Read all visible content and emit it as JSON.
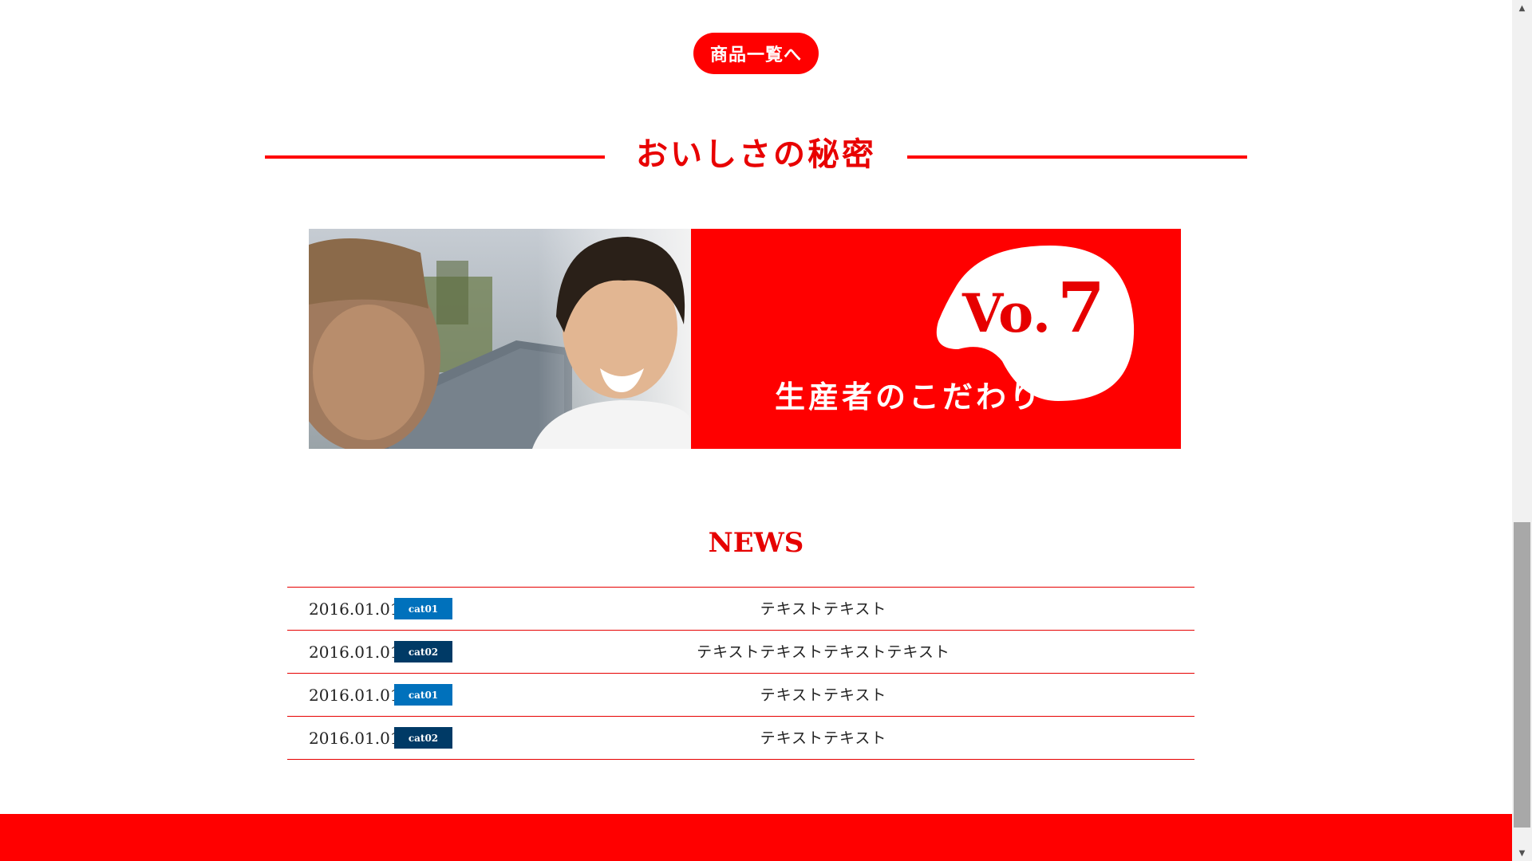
{
  "products_button": {
    "label": "商品一覧へ"
  },
  "section": {
    "title": "おいしさの秘密"
  },
  "banner": {
    "vo_label": "Vo.",
    "vo_number": "7",
    "caption": "生産者のこだわり"
  },
  "news": {
    "title": "NEWS",
    "items": [
      {
        "date": "2016.01.01",
        "category": "cat01",
        "text": "テキストテキスト"
      },
      {
        "date": "2016.01.01",
        "category": "cat02",
        "text": "テキストテキストテキストテキスト"
      },
      {
        "date": "2016.01.01",
        "category": "cat01",
        "text": "テキストテキスト"
      },
      {
        "date": "2016.01.01",
        "category": "cat02",
        "text": "テキストテキスト"
      }
    ]
  },
  "colors": {
    "brand_red": "#ff0000",
    "cat01": "#0071bc",
    "cat02": "#003a66"
  },
  "scrollbar": {
    "up_icon": "▲",
    "down_icon": "▼"
  }
}
